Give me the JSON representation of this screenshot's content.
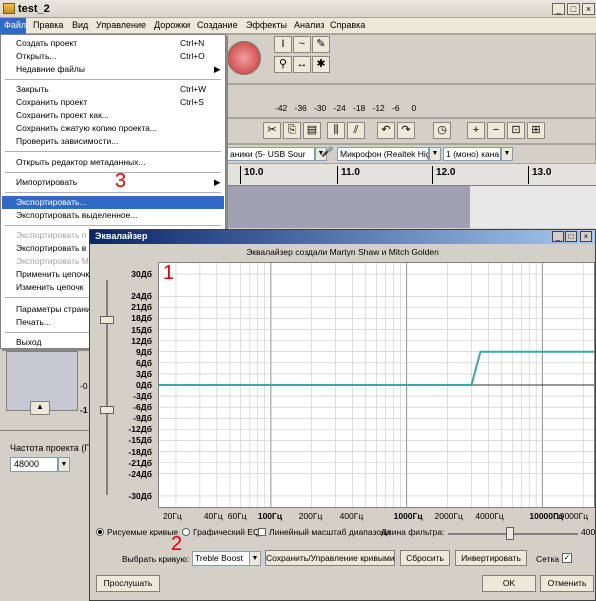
{
  "main_window": {
    "title": "test_2",
    "menu": [
      "Файл",
      "Правка",
      "Вид",
      "Управление",
      "Дорожки",
      "Создание",
      "Эффекты",
      "Анализ",
      "Справка"
    ],
    "meter_ticks": [
      "-42",
      "-36",
      "-30",
      "-24",
      "-18",
      "-12",
      "-6",
      "0"
    ],
    "timeline": [
      "10.0",
      "11.0",
      "12.0",
      "13.0"
    ],
    "device_output": "аники (5- USB Sour",
    "device_input": "Микрофон (Realtek Hig",
    "device_channels": "1 (моно) кана",
    "project_rate_label": "Частота проекта (Г",
    "project_rate_value": "48000",
    "track_scale": [
      "-0",
      "-1"
    ]
  },
  "file_menu": {
    "items": [
      {
        "label": "Создать проект",
        "shortcut": "Ctrl+N"
      },
      {
        "label": "Открыть...",
        "shortcut": "Ctrl+O"
      },
      {
        "label": "Недавние файлы",
        "arrow": "▶"
      },
      {
        "label": "Закрыть",
        "shortcut": "Ctrl+W"
      },
      {
        "label": "Сохранить проект",
        "shortcut": "Ctrl+S"
      },
      {
        "label": "Сохранить проект как..."
      },
      {
        "label": "Сохранить сжатую копию проекта..."
      },
      {
        "label": "Проверить зависимости..."
      },
      {
        "label": "Открыть редактор метаданных..."
      },
      {
        "label": "Импортировать",
        "arrow": "▶"
      },
      {
        "label": "Экспортировать..."
      },
      {
        "label": "Экспортировать выделенное..."
      },
      {
        "label": "Экспортировать п"
      },
      {
        "label": "Экспортировать в"
      },
      {
        "label": "Экспортировать М"
      },
      {
        "label": "Применить цепочк"
      },
      {
        "label": "Изменить цепочк"
      },
      {
        "label": "Параметры страни"
      },
      {
        "label": "Печать..."
      },
      {
        "label": "Выход"
      }
    ]
  },
  "annotations": {
    "one": "1",
    "two": "2",
    "three": "3"
  },
  "eq_dialog": {
    "title": "Эквалайзер",
    "credit": "Эквалайзер создали Martyn Shaw и Mitch Golden",
    "curve_mode_label": "Рисуемые кривые",
    "graphic_eq_label": "Графический EQ",
    "linear_scale_label": "Линейный масштаб диапазона",
    "filter_length_label": "Длина фильтра:",
    "filter_length_value": "400",
    "select_curve_label": "Выбрать кривую:",
    "select_curve_value": "Treble Boost",
    "save_manage_button": "Сохранить/Управление кривыми",
    "reset_button": "Сбросить",
    "invert_button": "Инвертировать",
    "grid_label": "Сетка",
    "preview_button": "Прослушать",
    "ok_button": "OK",
    "cancel_button": "Отменить"
  },
  "chart_data": {
    "type": "line",
    "ylabels": [
      "30Дб",
      "24Дб",
      "21Дб",
      "18Дб",
      "15Дб",
      "12Дб",
      "9Дб",
      "6Дб",
      "3Дб",
      "0Дб",
      "-3Дб",
      "-6Дб",
      "-9Дб",
      "-12Дб",
      "-15Дб",
      "-18Дб",
      "-21Дб",
      "-24Дб",
      "-30Дб"
    ],
    "yticks": [
      30,
      24,
      21,
      18,
      15,
      12,
      9,
      6,
      3,
      0,
      -3,
      -6,
      -9,
      -12,
      -15,
      -18,
      -21,
      -24,
      -30
    ],
    "xlabels": [
      "20Гц",
      "40Гц",
      "60Гц",
      "100Гц",
      "200Гц",
      "400Гц",
      "1000Гц",
      "2000Гц",
      "4000Гц",
      "10000Гц",
      "19000Гц"
    ],
    "xticks": [
      20,
      40,
      60,
      100,
      200,
      400,
      1000,
      2000,
      4000,
      10000,
      19000
    ],
    "xlim": [
      15,
      24000
    ],
    "ylim": [
      -33,
      33
    ],
    "xscale": "log",
    "grid": true,
    "series": [
      {
        "x": [
          15,
          3000,
          3500,
          24000
        ],
        "y": [
          0,
          0,
          9,
          9
        ]
      }
    ]
  },
  "colors": {
    "curve": "#3aa8a8",
    "highlight": "#316ac5",
    "annotation": "#e00000"
  }
}
